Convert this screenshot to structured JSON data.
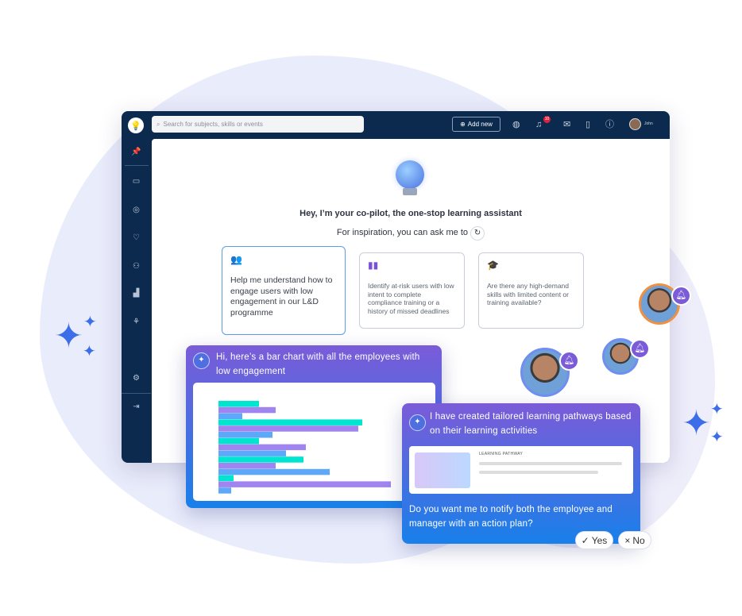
{
  "topbar": {
    "search_placeholder": "Search for subjects, skills or events",
    "add_new": "Add new",
    "notifications_count": "10",
    "user_name": "John"
  },
  "sidebar": {
    "icons": [
      "pin-icon",
      "courses-icon",
      "target-icon",
      "skills-icon",
      "people-icon",
      "analytics-icon",
      "org-chart-icon",
      "gear-icon",
      "collapse-icon"
    ]
  },
  "main": {
    "greeting": "Hey, I’m your co-pilot, the one-stop learning assistant",
    "inspiration": "For inspiration, you can ask me to",
    "cards": [
      {
        "icon": "users-gear-icon",
        "text": "Help me understand how to engage users with low engagement in our L&D programme"
      },
      {
        "icon": "bar-chart-icon",
        "text": "Identify at-risk users with low intent to complete compliance training or a history of missed deadlines"
      },
      {
        "icon": "graduation-cap-icon",
        "text": "Are there any high-demand skills with limited content or training available?"
      }
    ]
  },
  "chat1": {
    "message": "Hi, here’s a bar chart with all the employees with low engagement"
  },
  "chat2": {
    "message": "I have created tailored learning pathways based on their learning activities",
    "pathway_label": "LEARNING PATHWAY",
    "question": "Do you want me to notify both the employee and manager with an action plan?",
    "yes": "Yes",
    "no": "No"
  },
  "colors": {
    "navy": "#0b2a4e",
    "purple": "#7b5bd8",
    "blue": "#1880ea",
    "teal": "#00e5cf",
    "bar_purple": "#a084f0",
    "bar_blue": "#5ea8fa"
  },
  "chart_data": {
    "type": "bar",
    "orientation": "horizontal",
    "groups": 5,
    "series_colors": [
      "#00e5cf",
      "#a084f0",
      "#5ea8fa"
    ],
    "values": [
      [
        51,
        72,
        30
      ],
      [
        181,
        176,
        68
      ],
      [
        51,
        110,
        85
      ],
      [
        107,
        72,
        140
      ],
      [
        19,
        217,
        16
      ]
    ]
  }
}
